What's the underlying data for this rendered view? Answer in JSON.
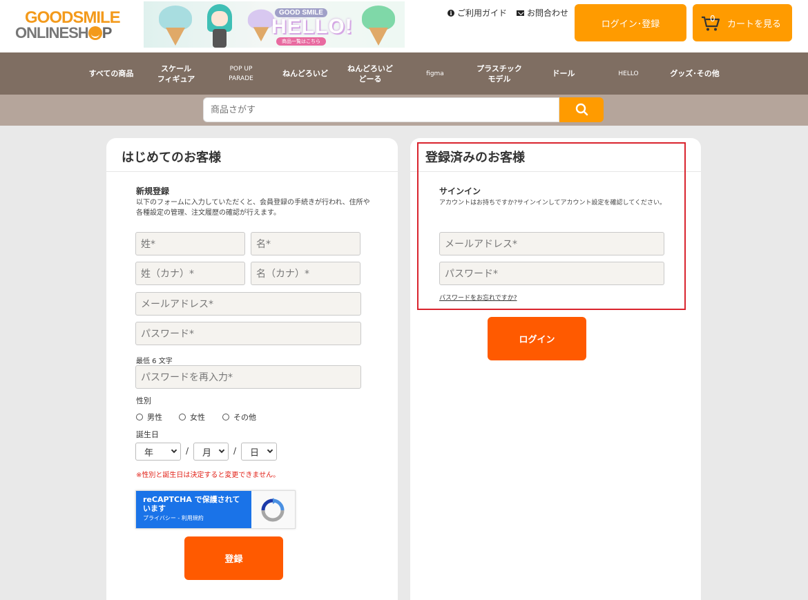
{
  "header": {
    "logo_line1": "GOODSMILE",
    "logo_line2_a": "ONLINESH",
    "logo_line2_b": "P",
    "banner_small": "GOOD SMILE",
    "banner_big": "HELLO!",
    "banner_sub": "商品一覧はこちら",
    "guide_link": "ご利用ガイド",
    "contact_link": "お問合わせ",
    "login_button": "ログイン･登録",
    "cart_count": "0",
    "cart_button": "カートを見る",
    "accent_color": "#ff9b00"
  },
  "nav": {
    "items": [
      {
        "label": "すべての商品"
      },
      {
        "label": "スケール\nフィギュア"
      },
      {
        "label": "POP UP\nPARADE"
      },
      {
        "label": "ねんどろいど"
      },
      {
        "label": "ねんどろいど\nどーる"
      },
      {
        "label": "figma"
      },
      {
        "label": "プラスチック\nモデル"
      },
      {
        "label": "ドール"
      },
      {
        "label": "HELLO"
      },
      {
        "label": "グッズ･その他"
      }
    ]
  },
  "search": {
    "placeholder": "商品さがす"
  },
  "new_customer": {
    "title": "はじめてのお客様",
    "section": "新規登録",
    "desc_line1": "以下のフォームに入力していただくと、会員登録の手続きが行われ、住所や",
    "desc_line2": "各種設定の管理、注文履歴の確認が行えます。",
    "last_name": "姓*",
    "first_name": "名*",
    "last_kana": "姓（カナ）*",
    "first_kana": "名（カナ）*",
    "email": "メールアドレス*",
    "password": "パスワード*",
    "min_chars": "最低 6 文字",
    "password_confirm": "パスワードを再入力*",
    "gender_label": "性別",
    "gender_options": [
      "男性",
      "女性",
      "その他"
    ],
    "birthday_label": "誕生日",
    "year": "年",
    "month": "月",
    "day": "日",
    "separator": "/",
    "warning": "※性別と誕生日は決定すると変更できません。",
    "recaptcha_title": "reCAPTCHA で保護されています",
    "recaptcha_links": "プライバシー - 利用規約",
    "register_button": "登録"
  },
  "returning_customer": {
    "title": "登録済みのお客様",
    "section": "サインイン",
    "desc": "アカウントはお持ちですか?サインインしてアカウント設定を確認してください。",
    "email": "メールアドレス*",
    "password": "パスワード*",
    "forgot": "パスワードをお忘れですか?",
    "login_button": "ログイン",
    "highlight_color": "#d9232d"
  }
}
